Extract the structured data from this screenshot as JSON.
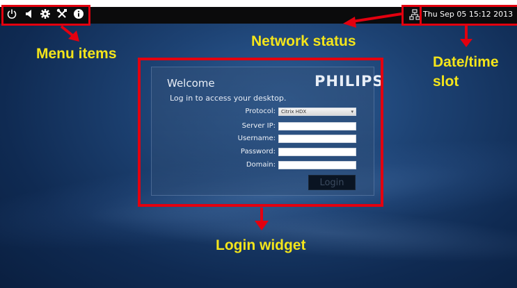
{
  "topbar": {
    "menu_icons": [
      "power-icon",
      "volume-icon",
      "gear-icon",
      "tools-icon",
      "info-icon"
    ],
    "network_icon": "network-icon",
    "datetime": "Thu Sep 05 15:12 2013"
  },
  "annotations": {
    "menu_items": "Menu items",
    "network_status": "Network status",
    "datetime_slot_line1": "Date/time",
    "datetime_slot_line2": "slot",
    "login_widget": "Login widget"
  },
  "login": {
    "welcome": "Welcome",
    "brand": "PHILIPS",
    "subtitle": "Log in to access your desktop.",
    "protocol_label": "Protocol:",
    "protocol_value": "Citrix HDX",
    "server_ip_label": "Server IP:",
    "username_label": "Username:",
    "password_label": "Password:",
    "domain_label": "Domain:",
    "login_button": "Login"
  },
  "colors": {
    "annotation_red": "#e3000f",
    "annotation_yellow": "#f4e51a",
    "topbar": "#0b0b0c"
  }
}
